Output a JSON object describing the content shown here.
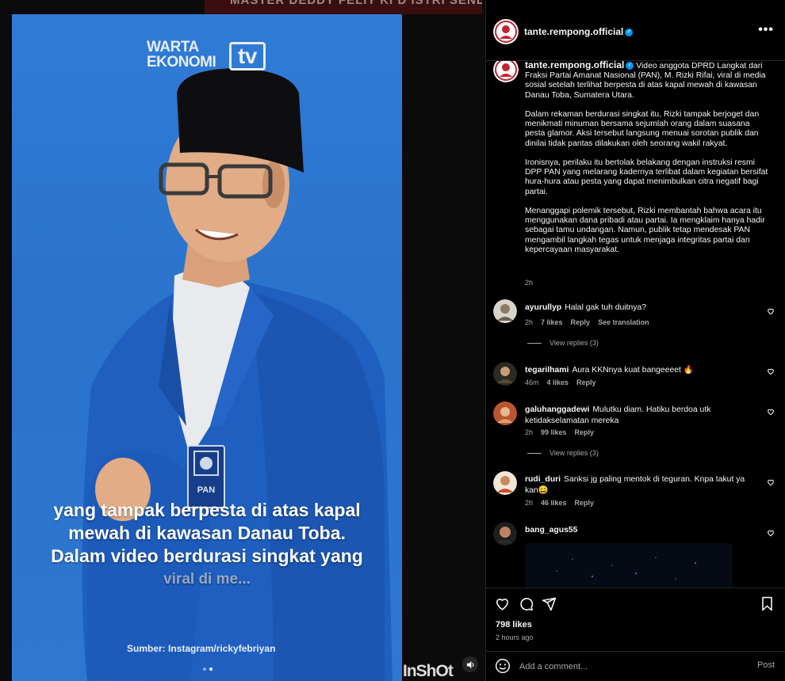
{
  "media": {
    "top_strip_text": "MASTER DEDDY FELIY KI D ISTRI SENDIRI TP ROYAL KBR ORANG",
    "logo_line1": "WARTA",
    "logo_line2": "EKONOMI",
    "logo_tv": "tv",
    "caption_lines": [
      "yang tampak berpesta di atas kapal",
      "mewah di kawasan Danau Toba.",
      "Dalam video berdurasi singkat yang",
      "viral di me..."
    ],
    "source": "Sumber: Instagram/rickyfebriyan",
    "watermark": "InShOt",
    "badge_text": "PAN",
    "colors": {
      "video_bg": "#2e78d2",
      "jacket": "#1f5fc0",
      "cap": "#0e0e10"
    }
  },
  "header": {
    "username": "tante.rempong.official",
    "more_icon": "more-horizontal-icon"
  },
  "post": {
    "username": "tante.rempong.official",
    "paragraphs": [
      "Video anggota DPRD Langkat dari Fraksi Partai Amanat Nasional (PAN), M. Rizki Rifai, viral di media sosial setelah terlihat berpesta di atas kapal mewah di kawasan Danau Toba, Sumatera Utara.",
      "Dalam rekaman berdurasi singkat itu, Rizki tampak berjoget dan menikmati minuman bersama sejumlah orang dalam suasana pesta glamor. Aksi tersebut langsung menuai sorotan publik dan dinilai tidak pantas dilakukan oleh seorang wakil rakyat.",
      "Ironisnya, perilaku itu bertolak belakang dengan instruksi resmi DPP PAN yang melarang kadernya terlibat dalam kegiatan bersifat hura-hura atau pesta yang dapat menimbulkan citra negatif bagi partai.",
      "Menanggapi polemik tersebut, Rizki membantah bahwa acara itu menggunakan dana pribadi atau partai. Ia mengklaim hanya hadir sebagai tamu undangan. Namun, publik tetap mendesak PAN mengambil langkah tegas untuk menjaga integritas partai dan kepercayaan masyarakat."
    ],
    "time": "2h"
  },
  "comments": [
    {
      "user": "ayurullyp",
      "text": "Halal gak tuh duitnya?",
      "time": "2h",
      "likes": "7 likes",
      "reply": "Reply",
      "translate": "See translation",
      "view_replies": "View replies (3)"
    },
    {
      "user": "tegarilhami",
      "text": "Aura KKNnya kuat bangeeeet 🔥",
      "time": "46m",
      "likes": "4 likes",
      "reply": "Reply"
    },
    {
      "user": "galuhanggadewi",
      "text": "Mulutku diam. Hatiku berdoa utk ketidakselamatan mereka",
      "time": "2h",
      "likes": "99 likes",
      "reply": "Reply",
      "view_replies": "View replies (3)"
    },
    {
      "user": "rudi_duri",
      "text": "Sanksi jg paling mentok di teguran. Knpa takut ya kan😄",
      "time": "2h",
      "likes": "46 likes",
      "reply": "Reply"
    },
    {
      "user": "bang_agus55",
      "text": ""
    }
  ],
  "actions": {
    "likes": "798 likes",
    "posted": "2 hours ago",
    "icons": [
      "heart-icon",
      "comment-icon",
      "share-icon",
      "bookmark-icon"
    ]
  },
  "comment_box": {
    "placeholder": "Add a comment...",
    "post_label": "Post"
  }
}
